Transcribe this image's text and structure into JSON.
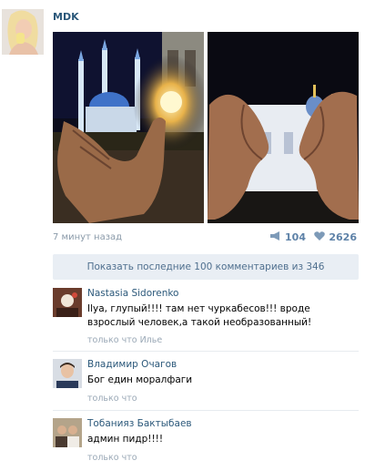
{
  "post": {
    "author": "MDK",
    "time": "7 минут назад",
    "shares": "104",
    "likes": "2626"
  },
  "show_more_label": "Показать последние 100 комментариев из 346",
  "comments": [
    {
      "name": "Nastasia Sidorenko",
      "text": "Ilya, глупый!!!! там нет чуркабесов!!! вроде взрослый человек,а такой необразованный!",
      "time": "только что Илье"
    },
    {
      "name": "Владимир Очагов",
      "text": "Бог един моралфаги",
      "time": "только что"
    },
    {
      "name": "Тобанияз Бактыбаев",
      "text": "админ пидр!!!!",
      "time": "только что"
    }
  ],
  "colors": {
    "link": "#2b587a",
    "meta": "#8a9aa9",
    "button_bg": "#e9eef4",
    "counter": "#5e82a8"
  },
  "icons": [
    "megaphone-icon",
    "heart-icon"
  ]
}
